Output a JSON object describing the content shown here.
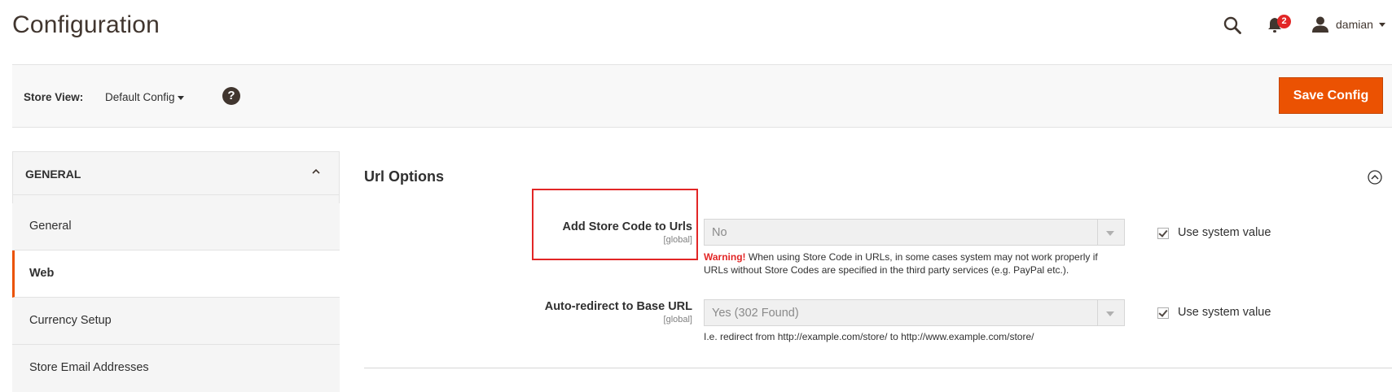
{
  "header": {
    "title": "Configuration",
    "notification_count": "2",
    "user_name": "damian"
  },
  "store_bar": {
    "label": "Store View:",
    "value": "Default Config",
    "help": "?",
    "save_label": "Save Config"
  },
  "sidebar": {
    "title": "GENERAL",
    "items": [
      {
        "label": "General"
      },
      {
        "label": "Web"
      },
      {
        "label": "Currency Setup"
      },
      {
        "label": "Store Email Addresses"
      }
    ],
    "active": "Web"
  },
  "section": {
    "title": "Url Options",
    "fields": [
      {
        "label": "Add Store Code to Urls",
        "scope": "[global]",
        "value": "No",
        "use_system_label": "Use system value",
        "use_system_checked": true,
        "warning_prefix": "Warning!",
        "note": " When using Store Code in URLs, in some cases system may not work properly if URLs without Store Codes are specified in the third party services (e.g. PayPal etc.)."
      },
      {
        "label": "Auto-redirect to Base URL",
        "scope": "[global]",
        "value": "Yes (302 Found)",
        "use_system_label": "Use system value",
        "use_system_checked": true,
        "note": "I.e. redirect from http://example.com/store/ to http://www.example.com/store/"
      }
    ]
  },
  "colors": {
    "accent": "#eb5202",
    "highlight": "#e22626",
    "badge": "#e22626"
  }
}
